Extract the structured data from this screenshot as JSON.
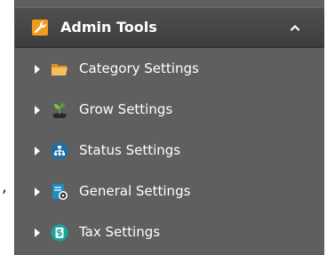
{
  "stray_text": ",",
  "admin_tools": {
    "title": "Admin Tools",
    "header_icon": "wrench-icon",
    "collapse_icon": "chevron-up-icon",
    "items": [
      {
        "label": "Category Settings",
        "icon": "folder-icon"
      },
      {
        "label": "Grow Settings",
        "icon": "sprout-icon"
      },
      {
        "label": "Status Settings",
        "icon": "hierarchy-icon"
      },
      {
        "label": "General Settings",
        "icon": "document-gear-icon"
      },
      {
        "label": "Tax Settings",
        "icon": "dollar-icon"
      }
    ]
  },
  "colors": {
    "panel": "#5f5f5f",
    "header": "#454545",
    "accent": "#f29a1e",
    "text": "#ffffff"
  }
}
